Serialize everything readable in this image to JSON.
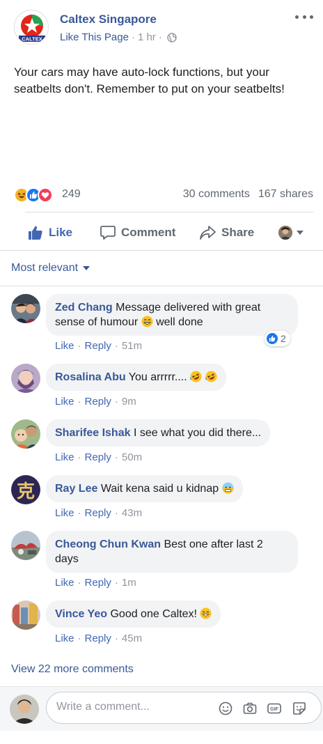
{
  "post": {
    "page_name": "Caltex Singapore",
    "like_page": "Like This Page",
    "time": "1 hr",
    "audience_icon": "globe-icon",
    "logo_text": "CALTEX",
    "text": "Your cars may have auto-lock functions, but your seatbelts don't. Remember to put on your seatbelts!",
    "reaction_icons": [
      "haha-reaction-icon",
      "like-reaction-icon",
      "love-reaction-icon"
    ],
    "reaction_count": "249",
    "comments_count": "30 comments",
    "shares_count": "167 shares"
  },
  "actions": {
    "like": "Like",
    "comment": "Comment",
    "share": "Share"
  },
  "sort": {
    "label": "Most relevant"
  },
  "comments": [
    {
      "author": "Zed Chang",
      "text": "Message delivered with great sense of humour",
      "text_after": " well done",
      "emoji": "grin-emoji",
      "like": "Like",
      "reply": "Reply",
      "time": "51m",
      "likes": "2"
    },
    {
      "author": "Rosalina Abu",
      "text": "You arrrrr....",
      "emoji": "rofl-emoji",
      "like": "Like",
      "reply": "Reply",
      "time": "9m"
    },
    {
      "author": "Sharifee Ishak",
      "text": "I see what you did there...",
      "like": "Like",
      "reply": "Reply",
      "time": "50m"
    },
    {
      "author": "Ray Lee",
      "text": "Wait kena said u kidnap",
      "emoji": "cold-sweat-emoji",
      "avatar_char": "克",
      "like": "Like",
      "reply": "Reply",
      "time": "43m"
    },
    {
      "author": "Cheong Chun Kwan",
      "text": "Best one after last 2 days",
      "like": "Like",
      "reply": "Reply",
      "time": "1m"
    },
    {
      "author": "Vince Yeo",
      "text": "Good one Caltex!",
      "emoji": "smile-emoji",
      "like": "Like",
      "reply": "Reply",
      "time": "45m"
    }
  ],
  "view_more": "View 22 more comments",
  "composer": {
    "placeholder": "Write a comment...",
    "icons": [
      "emoji-icon",
      "camera-icon",
      "gif-icon",
      "sticker-icon"
    ],
    "gif_label": "GIF"
  },
  "colors": {
    "link_blue": "#385898",
    "like_blue": "#4267b2",
    "caltex_red": "#e1251b",
    "caltex_green": "#2aa14f"
  }
}
